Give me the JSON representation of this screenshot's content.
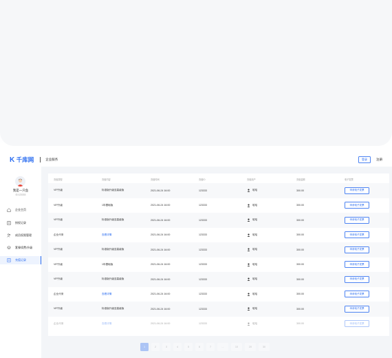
{
  "header": {
    "logo_text": "千库网",
    "logo_sub": "企业服务",
    "login_label": "登录",
    "register_label": "注册"
  },
  "user": {
    "name": "我是一只鱼",
    "id": "ID:123333"
  },
  "sidebar": {
    "items": [
      {
        "label": "企业主页",
        "icon": "home-icon",
        "active": false
      },
      {
        "label": "授权记录",
        "icon": "document-icon",
        "active": false
      },
      {
        "label": "成员权限管理",
        "icon": "users-icon",
        "active": false
      },
      {
        "label": "套餐续费/升级",
        "icon": "layers-icon",
        "active": false
      },
      {
        "label": "充值记录",
        "icon": "receipt-icon",
        "active": true
      }
    ]
  },
  "table": {
    "columns": [
      "充值类型",
      "充值内容",
      "充值时间",
      "充值ID",
      "充值用户",
      "充值金额",
      "电子发票"
    ],
    "rows": [
      {
        "type": "VIP升级",
        "content": "标准版升级至高级版",
        "time": "2021-06-24  16:00",
        "id": "123333",
        "user": "哈哈",
        "amount": "300.00",
        "invoice": "申请电子发票",
        "link": false
      },
      {
        "type": "VIP升级",
        "content": "1年基础版",
        "time": "2021-06-24  16:00",
        "id": "123333",
        "user": "哈哈",
        "amount": "300.00",
        "invoice": "申请电子发票",
        "link": false
      },
      {
        "type": "VIP升级",
        "content": "标准版升级至高级版",
        "time": "2021-06-24  16:00",
        "id": "123333",
        "user": "哈哈",
        "amount": "300.00",
        "invoice": "申请电子发票",
        "link": false
      },
      {
        "type": "企业代采",
        "content": "查看详情",
        "time": "2021-06-24  16:00",
        "id": "123333",
        "user": "哈哈",
        "amount": "300.00",
        "invoice": "申请电子发票",
        "link": true
      },
      {
        "type": "VIP升级",
        "content": "标准版升级至高级版",
        "time": "2021-06-24  16:00",
        "id": "123333",
        "user": "哈哈",
        "amount": "300.00",
        "invoice": "申请电子发票",
        "link": false
      },
      {
        "type": "VIP升级",
        "content": "1年基础版",
        "time": "2021-06-24  16:00",
        "id": "123333",
        "user": "哈哈",
        "amount": "300.00",
        "invoice": "申请电子发票",
        "link": false
      },
      {
        "type": "VIP升级",
        "content": "标准版升级至高级版",
        "time": "2021-06-24  16:00",
        "id": "123333",
        "user": "哈哈",
        "amount": "300.00",
        "invoice": "申请电子发票",
        "link": false
      },
      {
        "type": "企业代采",
        "content": "查看详情",
        "time": "2021-06-24  16:00",
        "id": "123333",
        "user": "哈哈",
        "amount": "300.00",
        "invoice": "申请电子发票",
        "link": true
      },
      {
        "type": "VIP升级",
        "content": "标准版升级至高级版",
        "time": "2021-06-24  16:00",
        "id": "123333",
        "user": "哈哈",
        "amount": "300.00",
        "invoice": "申请电子发票",
        "link": false
      },
      {
        "type": "企业代采",
        "content": "查看详情",
        "time": "2021-06-24  16:00",
        "id": "123333",
        "user": "哈哈",
        "amount": "300.00",
        "invoice": "申请电子发票",
        "link": true
      }
    ]
  },
  "pagination": {
    "pages": [
      "1",
      "2",
      "3",
      "4",
      "5",
      "6",
      "7",
      "...",
      "10",
      "20",
      "30"
    ],
    "active": "1"
  },
  "colors": {
    "accent": "#2a6cf0"
  }
}
